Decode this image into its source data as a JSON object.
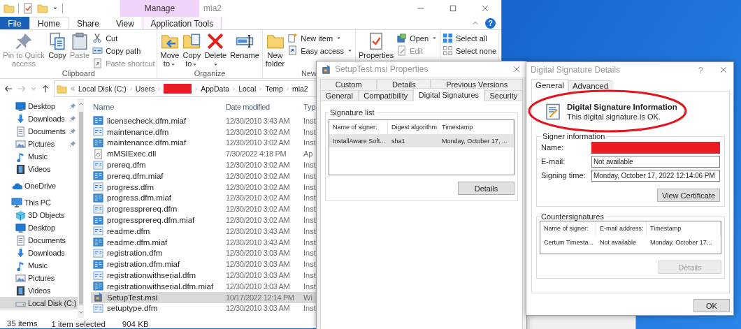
{
  "explorer": {
    "title": "mia2",
    "context_header": "Manage",
    "help_label": "?",
    "tabs": [
      {
        "label": "File",
        "kind": "file",
        "selected": false
      },
      {
        "label": "Home",
        "kind": "tab",
        "selected": true
      },
      {
        "label": "Share",
        "kind": "tab",
        "selected": false
      },
      {
        "label": "View",
        "kind": "tab",
        "selected": false
      },
      {
        "label": "Application Tools",
        "kind": "context",
        "selected": false
      }
    ],
    "ribbon": [
      {
        "label": "Clipboard",
        "columns": [
          [
            {
              "label": "Pin to Quick access",
              "kind": "pin",
              "disabled": true,
              "dropdown": false
            }
          ],
          [
            {
              "label": "Copy",
              "kind": "copy",
              "disabled": false,
              "dropdown": false
            }
          ],
          [
            {
              "label": "Paste",
              "kind": "paste",
              "disabled": true,
              "dropdown": false
            }
          ],
          [
            {
              "label": "Cut",
              "kind": "cut",
              "disabled": false,
              "dropdown": false
            },
            {
              "label": "Copy path",
              "kind": "copypath",
              "disabled": false,
              "dropdown": false
            },
            {
              "label": "Paste shortcut",
              "kind": "pasteshortcut",
              "disabled": true,
              "dropdown": false
            }
          ]
        ]
      },
      {
        "label": "Organize",
        "columns": [
          [
            {
              "label": "Move to",
              "kind": "moveto",
              "disabled": false,
              "dropdown": true
            }
          ],
          [
            {
              "label": "Copy to",
              "kind": "copyto",
              "disabled": false,
              "dropdown": true
            }
          ],
          [
            {
              "label": "Delete",
              "kind": "delete",
              "disabled": false,
              "dropdown": true
            }
          ],
          [
            {
              "label": "Rename",
              "kind": "rename",
              "disabled": false,
              "dropdown": false
            }
          ]
        ]
      },
      {
        "label": "New",
        "columns": [
          [
            {
              "label": "New folder",
              "kind": "newfolder",
              "disabled": false,
              "dropdown": false
            }
          ],
          [
            {
              "label": "New item",
              "kind": "newitem",
              "disabled": false,
              "dropdown": true
            },
            {
              "label": "Easy access",
              "kind": "easyaccess",
              "disabled": false,
              "dropdown": true
            }
          ]
        ]
      },
      {
        "columns": [
          [
            {
              "label": "Properties",
              "kind": "properties",
              "disabled": false,
              "dropdown": false
            }
          ],
          [
            {
              "label": "Open",
              "kind": "open",
              "disabled": false,
              "dropdown": true
            },
            {
              "label": "Edit",
              "kind": "edit",
              "disabled": true,
              "dropdown": false
            }
          ]
        ]
      },
      {
        "columns": [
          [
            {
              "label": "Select all",
              "kind": "selectall",
              "disabled": false,
              "dropdown": false
            },
            {
              "label": "Select none",
              "kind": "selectnone",
              "disabled": false,
              "dropdown": false
            }
          ]
        ]
      }
    ],
    "path": [
      {
        "label": "Local Disk (C:)",
        "redacted": false
      },
      {
        "label": "Users",
        "redacted": false
      },
      {
        "redacted": true
      },
      {
        "label": "AppData",
        "redacted": false
      },
      {
        "label": "Local",
        "redacted": false
      },
      {
        "label": "Temp",
        "redacted": false
      },
      {
        "label": "mia2",
        "redacted": false
      }
    ],
    "quick_access": [
      {
        "label": "Desktop",
        "kind": "desktop",
        "pinned": true,
        "selected": false
      },
      {
        "label": "Downloads",
        "kind": "downloads",
        "pinned": true,
        "selected": false
      },
      {
        "label": "Documents",
        "kind": "documents",
        "pinned": true,
        "selected": false
      },
      {
        "label": "Pictures",
        "kind": "pictures",
        "pinned": true,
        "selected": false
      },
      {
        "label": "Music",
        "kind": "music",
        "pinned": false,
        "selected": false
      },
      {
        "label": "Videos",
        "kind": "videos",
        "pinned": false,
        "selected": false
      }
    ],
    "nav": [
      {
        "label": "OneDrive",
        "kind": "onedrive",
        "selected": false
      },
      {
        "label": "This PC",
        "kind": "pc",
        "selected": false,
        "children": [
          {
            "label": "3D Objects",
            "kind": "objects3d",
            "selected": false
          },
          {
            "label": "Desktop",
            "kind": "desktop",
            "selected": false
          },
          {
            "label": "Documents",
            "kind": "documents",
            "selected": false
          },
          {
            "label": "Downloads",
            "kind": "downloads",
            "selected": false
          },
          {
            "label": "Music",
            "kind": "music",
            "selected": false
          },
          {
            "label": "Pictures",
            "kind": "pictures",
            "selected": false
          },
          {
            "label": "Videos",
            "kind": "videos",
            "selected": false
          },
          {
            "label": "Local Disk (C:)",
            "kind": "drive",
            "selected": true
          }
        ]
      }
    ],
    "columns": [
      "Name",
      "Date modified",
      "Typ"
    ],
    "files": [
      {
        "name": "licensecheck.dfm.miaf",
        "date": "12/30/2010 3:43 AM",
        "type": "Inst",
        "kind": "form",
        "selected": false
      },
      {
        "name": "maintenance.dfm",
        "date": "12/30/2010 3:02 AM",
        "type": "Inst",
        "kind": "formlight",
        "selected": false
      },
      {
        "name": "maintenance.dfm.miaf",
        "date": "12/30/2010 3:02 AM",
        "type": "Inst",
        "kind": "form",
        "selected": false
      },
      {
        "name": "mMSIExec.dll",
        "date": "7/30/2022 4:18 PM",
        "type": "Ap",
        "kind": "dll",
        "selected": false
      },
      {
        "name": "prereq.dfm",
        "date": "12/30/2010 3:02 AM",
        "type": "Inst",
        "kind": "formlight",
        "selected": false
      },
      {
        "name": "prereq.dfm.miaf",
        "date": "12/30/2010 3:02 AM",
        "type": "Inst",
        "kind": "form",
        "selected": false
      },
      {
        "name": "progress.dfm",
        "date": "12/30/2010 3:02 AM",
        "type": "Inst",
        "kind": "formlight",
        "selected": false
      },
      {
        "name": "progress.dfm.miaf",
        "date": "12/30/2010 3:02 AM",
        "type": "Inst",
        "kind": "form",
        "selected": false
      },
      {
        "name": "progressprereq.dfm",
        "date": "12/30/2010 3:02 AM",
        "type": "Inst",
        "kind": "formlight",
        "selected": false
      },
      {
        "name": "progressprereq.dfm.miaf",
        "date": "12/30/2010 3:02 AM",
        "type": "Inst",
        "kind": "form",
        "selected": false
      },
      {
        "name": "readme.dfm",
        "date": "12/30/2010 3:43 AM",
        "type": "Inst",
        "kind": "formlight",
        "selected": false
      },
      {
        "name": "readme.dfm.miaf",
        "date": "12/30/2010 3:43 AM",
        "type": "Inst",
        "kind": "form",
        "selected": false
      },
      {
        "name": "registration.dfm",
        "date": "12/30/2010 3:03 AM",
        "type": "Inst",
        "kind": "formlight",
        "selected": false
      },
      {
        "name": "registration.dfm.miaf",
        "date": "12/30/2010 3:03 AM",
        "type": "Inst",
        "kind": "form",
        "selected": false
      },
      {
        "name": "registrationwithserial.dfm",
        "date": "12/30/2010 3:03 AM",
        "type": "Inst",
        "kind": "formlight",
        "selected": false
      },
      {
        "name": "registrationwithserial.dfm.miaf",
        "date": "12/30/2010 3:03 AM",
        "type": "Inst",
        "kind": "form",
        "selected": false
      },
      {
        "name": "SetupTest.msi",
        "date": "10/17/2022 12:14 PM",
        "type": "Wi",
        "kind": "msi",
        "selected": true
      },
      {
        "name": "setuptype.dfm",
        "date": "12/30/2010 3:03 AM",
        "type": "Inst",
        "kind": "formlight",
        "selected": false
      }
    ],
    "status": [
      "35 items",
      "1 item selected",
      "904 KB"
    ]
  },
  "properties": {
    "title": "SetupTest.msi Properties",
    "tab_rows": [
      [
        {
          "label": "Custom",
          "selected": false
        },
        {
          "label": "Details",
          "selected": false
        },
        {
          "label": "Previous Versions",
          "selected": false
        }
      ],
      [
        {
          "label": "General",
          "selected": false
        },
        {
          "label": "Compatibility",
          "selected": false
        },
        {
          "label": "Digital Signatures",
          "selected": true
        },
        {
          "label": "Security",
          "selected": false
        }
      ]
    ],
    "group": "Signature list",
    "columns": [
      "Name of signer:",
      "Digest algorithm",
      "Timestamp"
    ],
    "rows": [
      {
        "cells": [
          "InstallAware Soft...",
          "sha1",
          "Monday, October 17, ..."
        ],
        "selected": true
      }
    ],
    "button": "Details"
  },
  "signature": {
    "title": "Digital Signature Details",
    "help_label": "?",
    "tabs": [
      {
        "label": "General",
        "selected": true
      },
      {
        "label": "Advanced",
        "selected": false
      }
    ],
    "heading": "Digital Signature Information",
    "status": "This digital signature is OK.",
    "signer_group": "Signer information",
    "fields": [
      {
        "label": "Name:",
        "redacted": true
      },
      {
        "label": "E-mail:",
        "value": "Not available",
        "redacted": false
      },
      {
        "label": "Signing time:",
        "value": "Monday, October 17, 2022 12:14:06 PM",
        "redacted": false
      }
    ],
    "view_button": "View Certificate",
    "counter_group": "Countersignatures",
    "columns": [
      "Name of signer:",
      "E-mail address:",
      "Timestamp"
    ],
    "rows": [
      {
        "cells": [
          "Certum Timesta...",
          "Not available",
          "Monday, October 17..."
        ],
        "selected": false
      }
    ],
    "details_button": {
      "label": "Details",
      "disabled": true
    },
    "ok_button": "OK"
  }
}
